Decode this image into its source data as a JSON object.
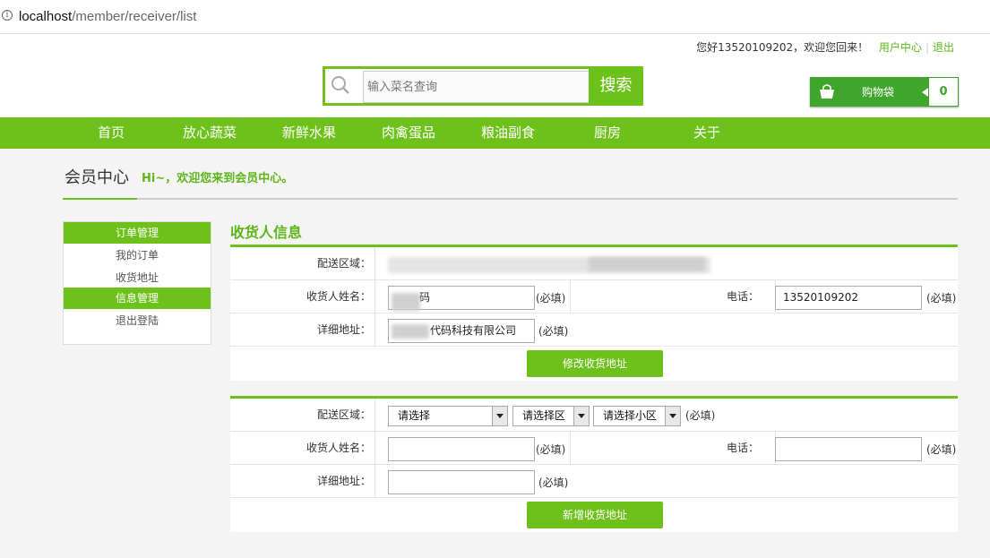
{
  "browser": {
    "url_host": "localhost",
    "url_path": "/member/receiver/list"
  },
  "header": {
    "greeting": "您好13520109202，欢迎您回来！",
    "user_center": "用户中心",
    "logout": "退出",
    "search_placeholder": "输入菜名查询",
    "search_button": "搜索",
    "cart_label": "购物袋",
    "cart_count": "0"
  },
  "nav": [
    "首页",
    "放心蔬菜",
    "新鲜水果",
    "肉禽蛋品",
    "粮油副食",
    "厨房",
    "关于"
  ],
  "member": {
    "title": "会员中心",
    "welcome": "Hi~，欢迎您来到会员中心。"
  },
  "sidebar": {
    "order_head": "订单管理",
    "my_orders": "我的订单",
    "addresses": "收货地址",
    "info_head": "信息管理",
    "logout": "退出登陆"
  },
  "section_title": "收货人信息",
  "edit_form": {
    "area_label": "配送区域：",
    "name_label": "收货人姓名：",
    "name_value": "码",
    "phone_label": "电话：",
    "phone_value": "13520109202",
    "address_label": "详细地址：",
    "address_value": "代码科技有限公司",
    "required": "(必填)",
    "submit": "修改收货地址"
  },
  "new_form": {
    "area_label": "配送区域：",
    "select_city": "请选择",
    "select_district": "请选择区",
    "select_community": "请选择小区",
    "name_label": "收货人姓名：",
    "phone_label": "电话：",
    "address_label": "详细地址：",
    "required": "(必填)",
    "submit": "新增收货地址"
  }
}
